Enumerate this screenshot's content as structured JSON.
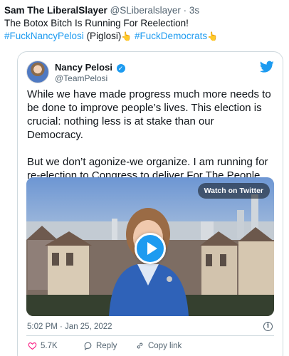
{
  "outer_tweet": {
    "name": "Sam The LiberalSlayer",
    "handle": "@SLiberalslayer",
    "time": "3s",
    "text_line1": "The Botox Bitch Is Running For Reelection!",
    "hashtag1": "#FuckNancyPelosi",
    "aside": "(Piglosi)",
    "hashtag2": "#FuckDemocrats",
    "emoji": "👆"
  },
  "embedded_tweet": {
    "author_name": "Nancy Pelosi",
    "author_handle": "@TeamPelosi",
    "paragraph1": "While we have made progress much more needs to be done to improve people’s lives. This election is crucial: nothing less is at stake than our Democracy.",
    "paragraph2": "But we don’t agonize-we organize. I am running for re-election to Congress to deliver For The People and defend Democracy. -NP",
    "watch_label": "Watch on Twitter",
    "timestamp": "5:02 PM · Jan 25, 2022",
    "likes": "5.7K",
    "reply_label": "Reply",
    "copy_label": "Copy link"
  },
  "colors": {
    "accent": "#1d9bf0",
    "muted": "#536471",
    "like": "#f91880"
  },
  "icons": [
    "verified-icon",
    "twitter-bird-icon",
    "play-icon",
    "info-icon",
    "heart-icon",
    "reply-icon",
    "link-icon"
  ]
}
